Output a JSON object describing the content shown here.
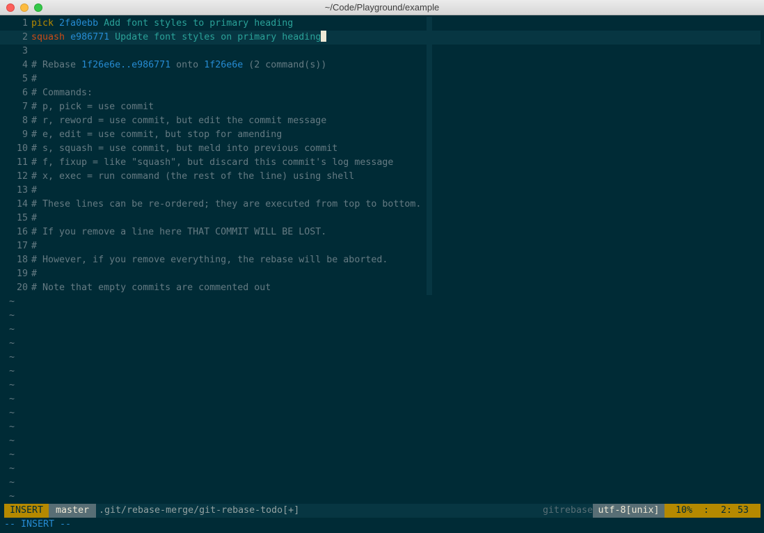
{
  "window": {
    "title": "~/Code/Playground/example"
  },
  "editor": {
    "lines": [
      {
        "num": "1",
        "kw": "pick",
        "hash": "2fa0ebb",
        "summary": "Add font styles to primary heading"
      },
      {
        "num": "2",
        "kw": "squash",
        "hash": "e986771",
        "summary": "Update font styles on primary heading"
      },
      {
        "num": "3"
      },
      {
        "num": "4",
        "c1": "# Rebase ",
        "h1": "1f26e6e..e986771",
        "c2": " onto ",
        "h2": "1f26e6e",
        "c3": " (2 command(s))"
      },
      {
        "num": "5",
        "text": "#"
      },
      {
        "num": "6",
        "text": "# Commands:"
      },
      {
        "num": "7",
        "text": "# p, pick = use commit"
      },
      {
        "num": "8",
        "text": "# r, reword = use commit, but edit the commit message"
      },
      {
        "num": "9",
        "text": "# e, edit = use commit, but stop for amending"
      },
      {
        "num": "10",
        "text": "# s, squash = use commit, but meld into previous commit"
      },
      {
        "num": "11",
        "text": "# f, fixup = like \"squash\", but discard this commit's log message"
      },
      {
        "num": "12",
        "text": "# x, exec = run command (the rest of the line) using shell"
      },
      {
        "num": "13",
        "text": "#"
      },
      {
        "num": "14",
        "text": "# These lines can be re-ordered; they are executed from top to bottom."
      },
      {
        "num": "15",
        "text": "#"
      },
      {
        "num": "16",
        "text": "# If you remove a line here THAT COMMIT WILL BE LOST."
      },
      {
        "num": "17",
        "text": "#"
      },
      {
        "num": "18",
        "text": "# However, if you remove everything, the rebase will be aborted."
      },
      {
        "num": "19",
        "text": "#"
      },
      {
        "num": "20",
        "text": "# Note that empty commits are commented out"
      }
    ],
    "tilde": "~"
  },
  "statusline": {
    "mode": "INSERT",
    "branch": "master",
    "file": ".git/rebase-merge/git-rebase-todo[+]",
    "filetype": "gitrebase",
    "encoding": "utf-8[unix]",
    "percent": "10%",
    "colon": ":",
    "linecol": "2: 53"
  },
  "cmdline": {
    "text": "-- INSERT --"
  },
  "colors": {
    "background": "#002b36",
    "accent_yellow": "#b58900",
    "accent_orange": "#cb4b16",
    "accent_blue": "#268bd2",
    "accent_cyan": "#2aa198",
    "comment": "#657b83"
  }
}
